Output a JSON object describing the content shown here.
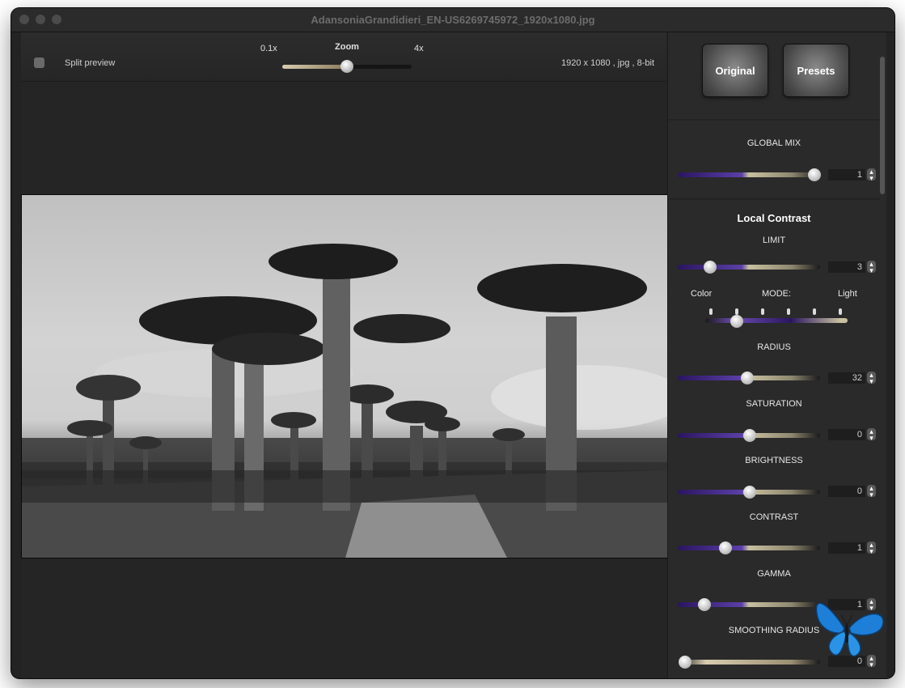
{
  "window": {
    "title": "AdansoniaGrandidieri_EN-US6269745972_1920x1080.jpg"
  },
  "toolbar": {
    "split_preview_label": "Split preview",
    "split_preview_checked": false,
    "zoom_label": "Zoom",
    "zoom_min_label": "0.1x",
    "zoom_max_label": "4x",
    "image_info": "1920 x 1080 , jpg , 8-bit"
  },
  "panel": {
    "original_button": "Original",
    "presets_button": "Presets",
    "global_mix": {
      "label": "GLOBAL MIX",
      "value": "1"
    },
    "local_contrast_title": "Local Contrast",
    "limit": {
      "label": "LIMIT",
      "value": "3"
    },
    "mode": {
      "label": "MODE:",
      "left_label": "Color",
      "right_label": "Light"
    },
    "radius": {
      "label": "RADIUS",
      "value": "32"
    },
    "saturation": {
      "label": "SATURATION",
      "value": "0"
    },
    "brightness": {
      "label": "BRIGHTNESS",
      "value": "0"
    },
    "contrast": {
      "label": "CONTRAST",
      "value": "1"
    },
    "gamma": {
      "label": "GAMMA",
      "value": "1"
    },
    "smoothing_radius": {
      "label": "SMOOTHING RADIUS",
      "value": "0"
    }
  },
  "icons": {
    "stepper": "up-down-stepper-icon",
    "mascot": "blue-butterfly-icon"
  }
}
